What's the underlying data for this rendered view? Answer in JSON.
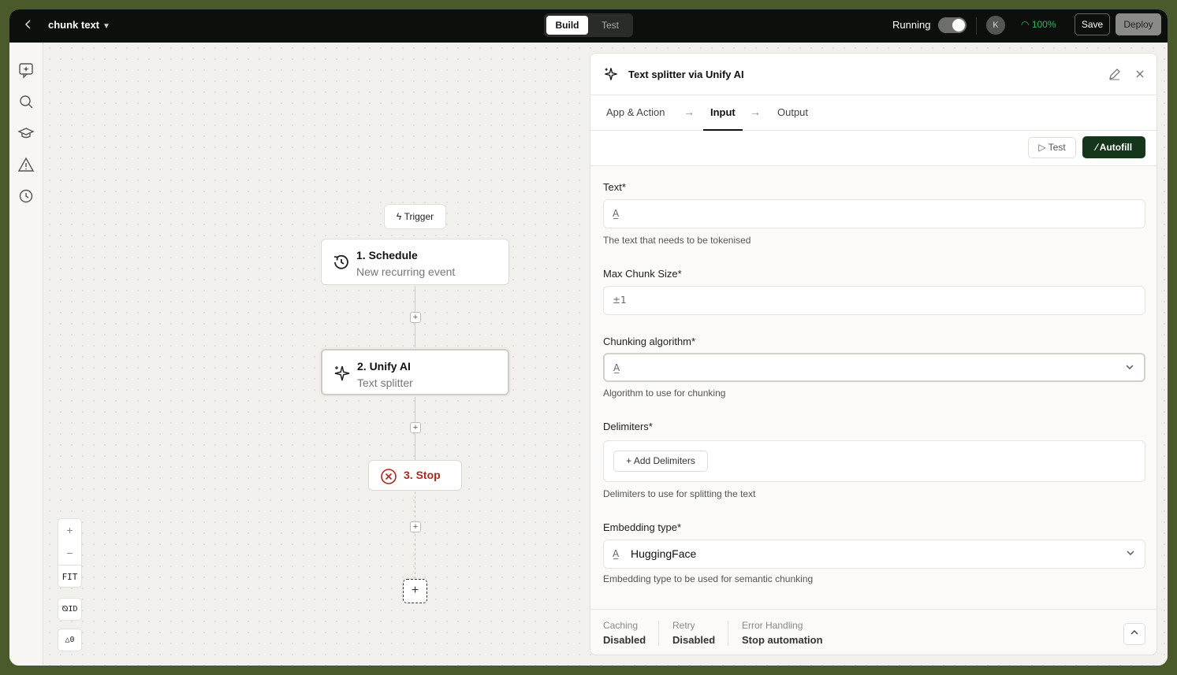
{
  "topbar": {
    "title": "chunk text",
    "mode_build": "Build",
    "mode_test": "Test",
    "running_label": "Running",
    "avatar_initial": "K",
    "health": "100%",
    "save_label": "Save",
    "deploy_label": "Deploy"
  },
  "canvas": {
    "trigger_label": "Trigger",
    "nodes": [
      {
        "title": "1. Schedule",
        "subtitle": "New recurring event"
      },
      {
        "title": "2. Unify AI",
        "subtitle": "Text splitter"
      },
      {
        "title": "3. Stop"
      }
    ],
    "zoom_fit": "FIT",
    "id_toggle": "ID",
    "warnings_count": "0"
  },
  "panel": {
    "title": "Text splitter via Unify AI",
    "tabs": [
      "App & Action",
      "Input",
      "Output"
    ],
    "active_tab": "Input",
    "test_label": "Test",
    "autofill_label": "Autofill",
    "fields": {
      "text": {
        "label": "Text*",
        "value": "",
        "help": "The text that needs to be tokenised"
      },
      "max_chunk": {
        "label": "Max Chunk Size*",
        "value": ""
      },
      "algorithm": {
        "label": "Chunking algorithm*",
        "value": "",
        "help": "Algorithm to use for chunking"
      },
      "delimiters": {
        "label": "Delimiters*",
        "button": "Add Delimiters",
        "help": "Delimiters to use for splitting the text"
      },
      "embedding": {
        "label": "Embedding type*",
        "value": "HuggingFace",
        "help": "Embedding type to be used for semantic chunking"
      }
    },
    "footer": {
      "caching": {
        "key": "Caching",
        "value": "Disabled"
      },
      "retry": {
        "key": "Retry",
        "value": "Disabled"
      },
      "error": {
        "key": "Error Handling",
        "value": "Stop automation"
      }
    }
  },
  "colors": {
    "accent": "#15361a",
    "stop": "#b3261e",
    "health": "#2fb566"
  }
}
